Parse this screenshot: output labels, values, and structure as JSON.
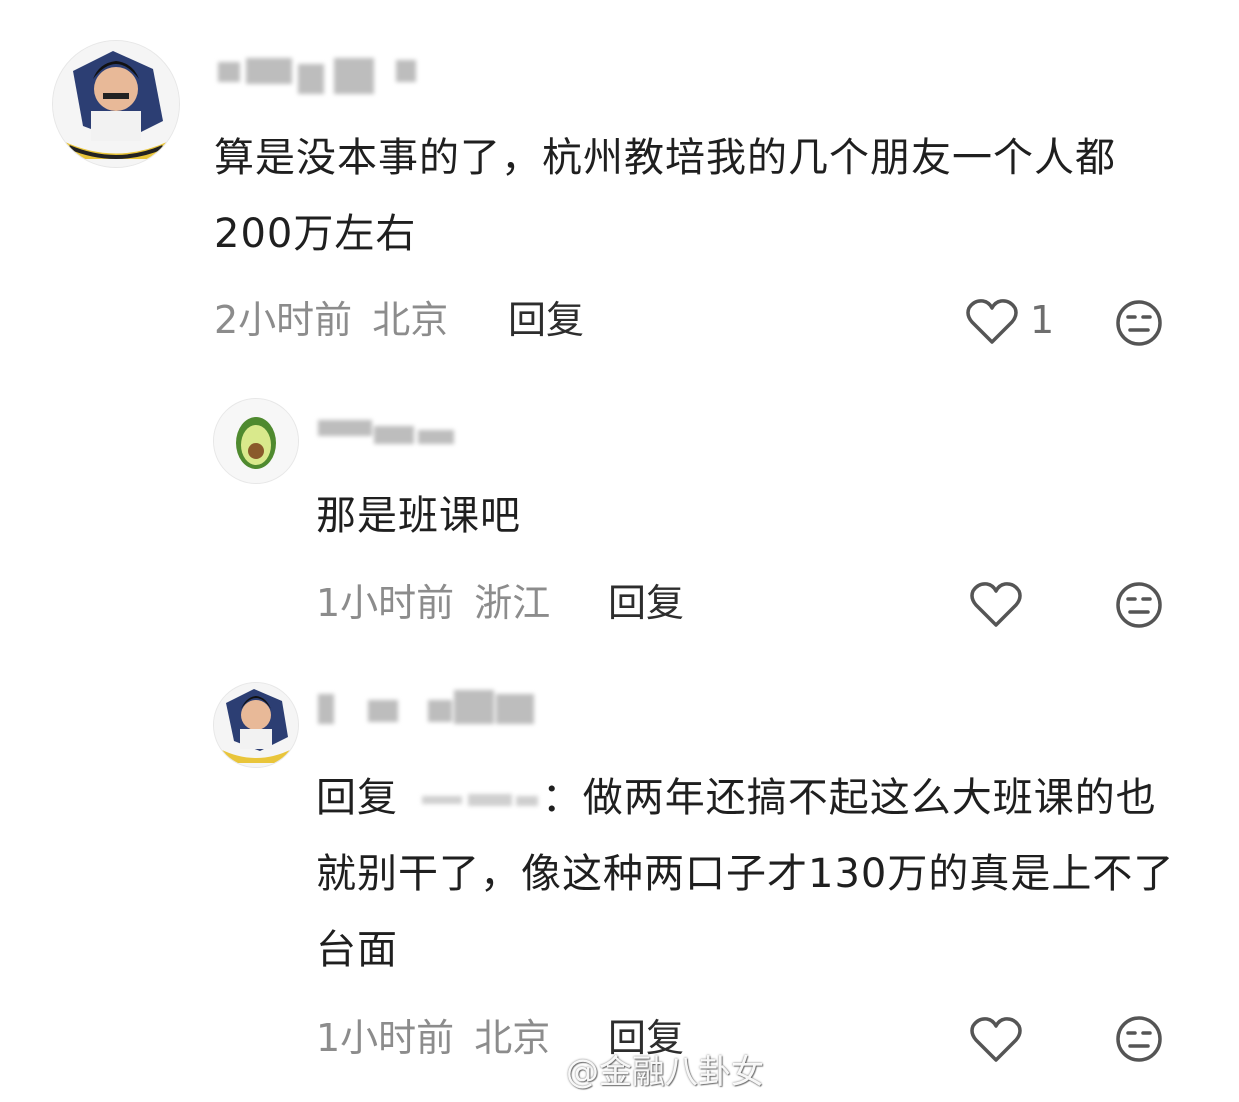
{
  "comments": [
    {
      "text": "算是没本事的了，杭州教培我的几个朋友一个人都200万左右",
      "time": "2小时前",
      "location": "北京",
      "reply_label": "回复",
      "like_count": "1"
    },
    {
      "text": "那是班课吧",
      "time": "1小时前",
      "location": "浙江",
      "reply_label": "回复",
      "like_count": ""
    },
    {
      "text_prefix": "回复",
      "text_suffix": "：做两年还搞不起这么大班课的也就别干了，像这种两口子才130万的真是上不了台面",
      "time": "1小时前",
      "location": "北京",
      "reply_label": "回复",
      "like_count": ""
    }
  ],
  "watermark": "@金融八卦女",
  "icons": {
    "like": "heart-outline-icon",
    "dislike": "meh-face-icon"
  },
  "colors": {
    "text": "#1f1f1f",
    "meta": "#8c8c8c",
    "icon": "#555555"
  }
}
